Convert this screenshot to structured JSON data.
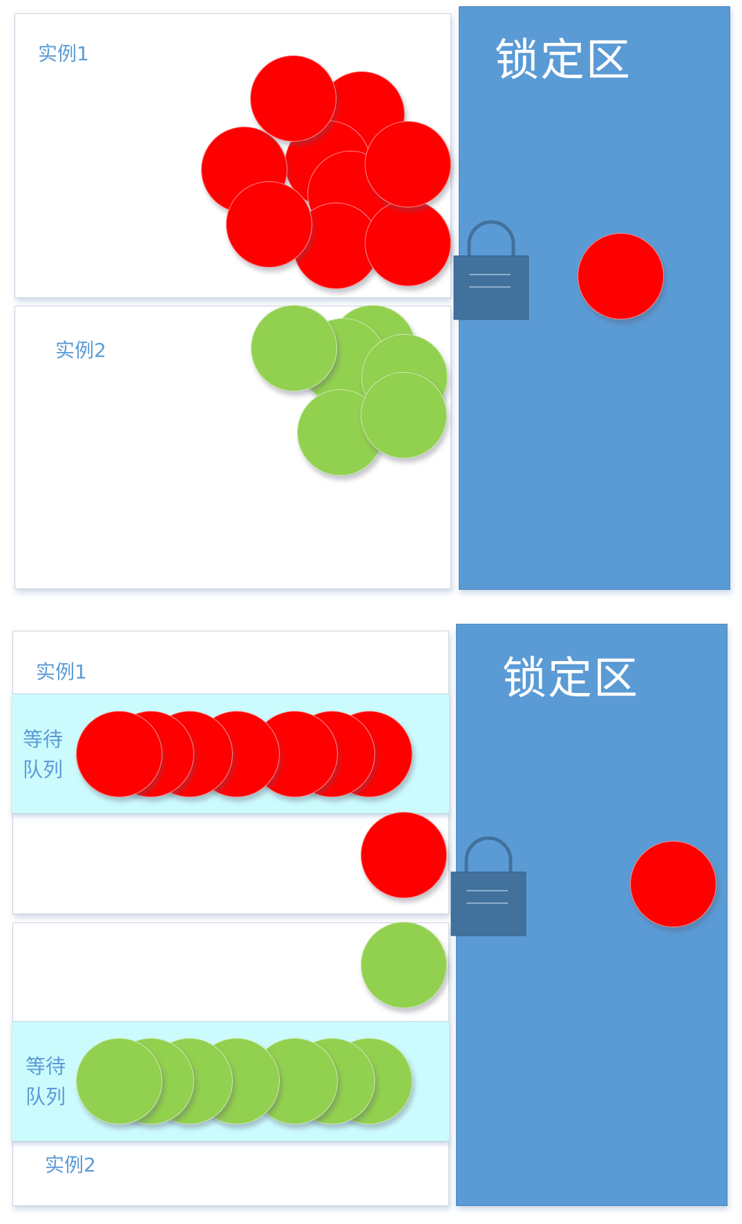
{
  "colors": {
    "locked_zone": "#5b9bd5",
    "lock": "#41719c",
    "queue_bg": "#ccfbfd",
    "red_ball": "#ff0000",
    "green_ball": "#92d050",
    "label_text": "#5b9bd5"
  },
  "top": {
    "instance1_label": "实例1",
    "instance2_label": "实例2",
    "zone_title": "锁定区",
    "red_ball_count": 9,
    "green_ball_count": 6
  },
  "bottom": {
    "instance1_label": "实例1",
    "instance2_label": "实例2",
    "zone_title": "锁定区",
    "queue1_label_line1": "等待",
    "queue1_label_line2": "队列",
    "queue2_label_line1": "等待",
    "queue2_label_line2": "队列",
    "queue1_ball_count": 7,
    "queue2_ball_count": 7
  },
  "icons": [
    "lock-icon"
  ]
}
